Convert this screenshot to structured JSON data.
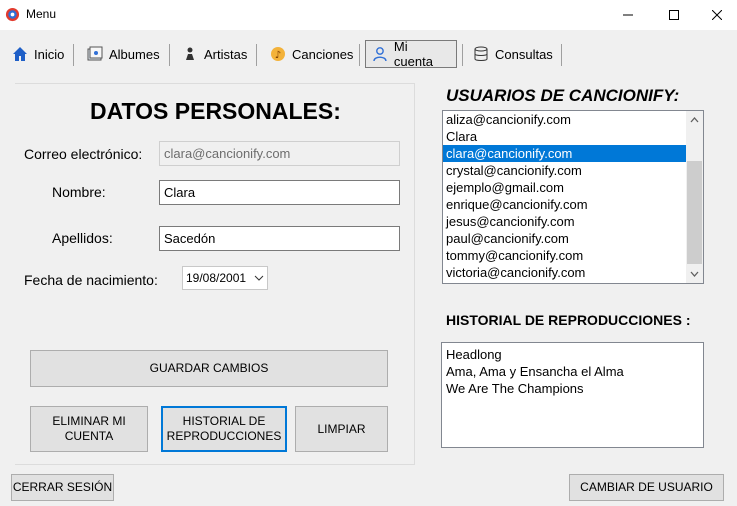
{
  "window": {
    "title": "Menu"
  },
  "toolbar": {
    "items": [
      {
        "label": "Inicio",
        "icon": "home-icon"
      },
      {
        "label": "Albumes",
        "icon": "album-icon"
      },
      {
        "label": "Artistas",
        "icon": "artist-icon"
      },
      {
        "label": "Canciones",
        "icon": "song-icon"
      },
      {
        "label": "Mi cuenta",
        "icon": "user-icon"
      },
      {
        "label": "Consultas",
        "icon": "query-icon"
      }
    ],
    "active": "Mi cuenta"
  },
  "form": {
    "heading": "DATOS PERSONALES:",
    "email_label": "Correo electrónico:",
    "email_value": "clara@cancionify.com",
    "name_label": "Nombre:",
    "name_value": "Clara",
    "surname_label": "Apellidos:",
    "surname_value": "Sacedón",
    "birth_label": "Fecha de nacimiento:",
    "birth_value": "19/08/2001"
  },
  "buttons": {
    "save": "GUARDAR CAMBIOS",
    "delete_line1": "ELIMINAR MI",
    "delete_line2": "CUENTA",
    "history_line1": "HISTORIAL DE",
    "history_line2": "REPRODUCCIONES",
    "clear": "LIMPIAR",
    "logout": "CERRAR SESIÓN",
    "switch_user": "CAMBIAR DE USUARIO"
  },
  "users": {
    "heading": "USUARIOS DE CANCIONIFY:",
    "items": [
      "aliza@cancionify.com",
      "Clara",
      "clara@cancionify.com",
      "crystal@cancionify.com",
      "ejemplo@gmail.com",
      "enrique@cancionify.com",
      "jesus@cancionify.com",
      "paul@cancionify.com",
      "tommy@cancionify.com",
      "victoria@cancionify.com"
    ],
    "selected_index": 2
  },
  "history": {
    "heading": "HISTORIAL DE REPRODUCCIONES :",
    "items": [
      "Headlong",
      "Ama, Ama y Ensancha el Alma",
      "We Are The Champions"
    ]
  },
  "colors": {
    "accent": "#0078d7",
    "window_bg": "#f0f0f0"
  }
}
